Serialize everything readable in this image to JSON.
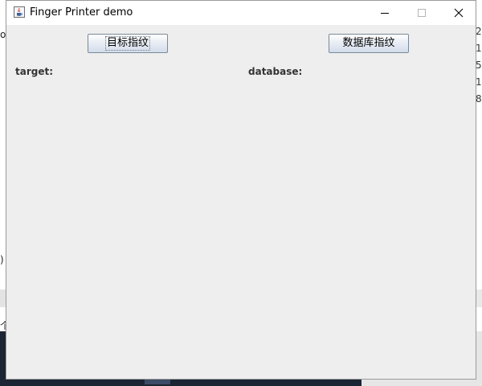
{
  "window": {
    "title": "Finger Printer demo",
    "controls": [
      "minimize",
      "maximize",
      "close"
    ]
  },
  "toolbar": {
    "target_button_label": "目标指纹",
    "database_button_label": "数据库指纹"
  },
  "panels": {
    "target_label": "target:",
    "database_label": "database:"
  },
  "background": {
    "left_edge_top": "o",
    "left_edge_mid": ")",
    "left_edge_lower": "个",
    "right_edge_digits": [
      "2",
      "1",
      "5",
      "1",
      "8"
    ]
  },
  "colors": {
    "window_bg": "#eeeeee",
    "titlebar_bg": "#ffffff",
    "button_border": "#7a8a99",
    "label_text": "#333333"
  },
  "icons": {
    "app": "java-cup-icon",
    "minimize": "minimize-icon",
    "maximize": "maximize-icon",
    "close": "close-icon"
  }
}
